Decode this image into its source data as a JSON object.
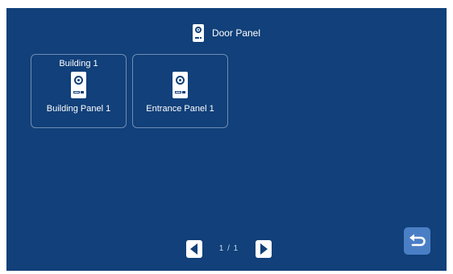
{
  "header": {
    "title": "Door Panel",
    "icon": "door-panel-icon"
  },
  "tiles": [
    {
      "top_label": "Building 1",
      "bottom_label": "Building Panel 1",
      "icon": "door-panel-icon"
    },
    {
      "top_label": "",
      "bottom_label": "Entrance Panel 1",
      "icon": "door-panel-icon"
    }
  ],
  "pager": {
    "prev_icon": "arrow-left-icon",
    "page_text": "1 / 1",
    "next_icon": "arrow-right-icon"
  },
  "back": {
    "icon": "return-arrow-icon"
  },
  "colors": {
    "background": "#11407a",
    "tile_border": "#6f8db3",
    "back_button": "#4a7fc5",
    "text": "#ffffff"
  }
}
